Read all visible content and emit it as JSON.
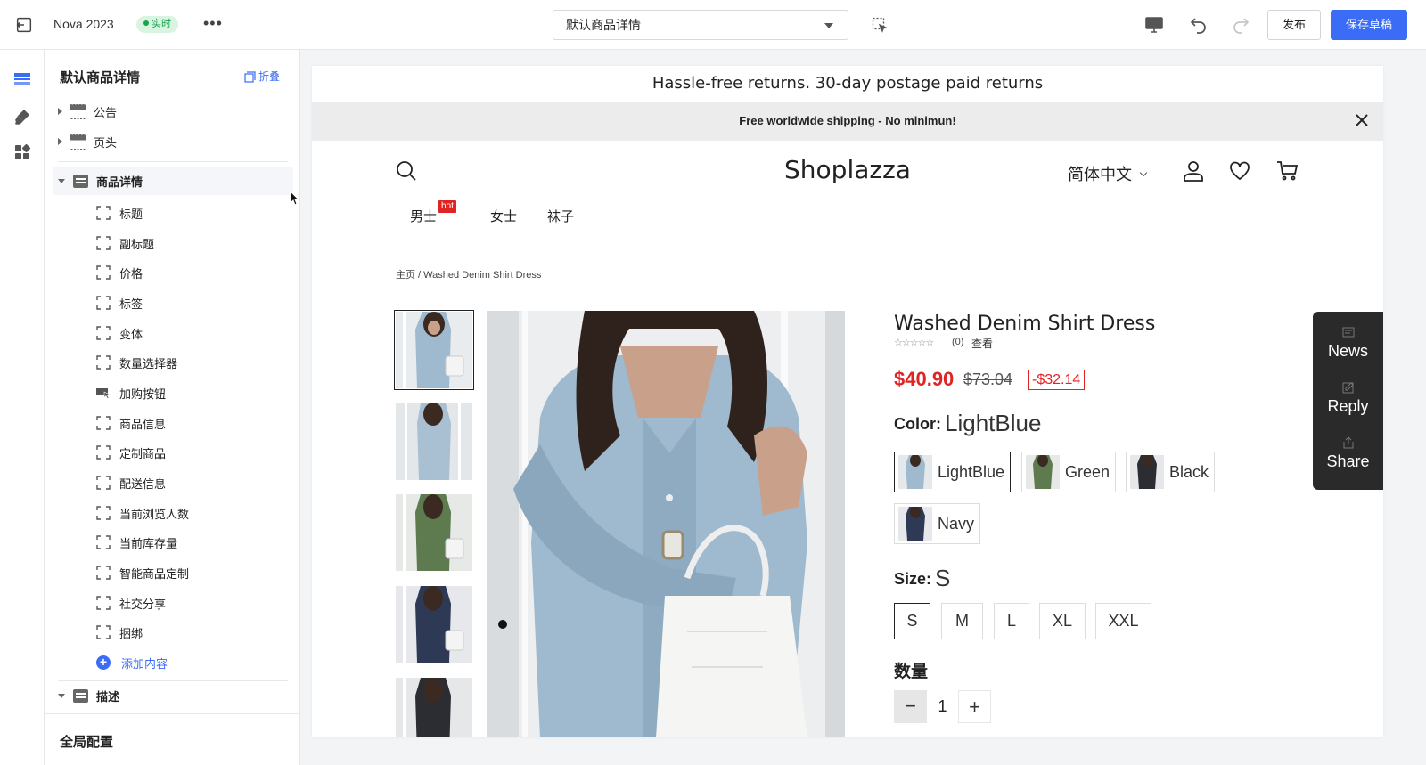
{
  "topbar": {
    "title": "Nova 2023",
    "badge": "实时",
    "more": "•••",
    "template_select": "默认商品详情",
    "publish": "发布",
    "save_draft": "保存草稿"
  },
  "sidebar": {
    "heading": "默认商品详情",
    "fold": "折叠",
    "sections": [
      {
        "label": "公告"
      },
      {
        "label": "页头"
      },
      {
        "label": "商品详情"
      },
      {
        "label": "描述"
      }
    ],
    "children": [
      "标题",
      "副标题",
      "价格",
      "标签",
      "变体",
      "数量选择器",
      "加购按钮",
      "商品信息",
      "定制商品",
      "配送信息",
      "当前浏览人数",
      "当前库存量",
      "智能商品定制",
      "社交分享",
      "捆绑"
    ],
    "add_content": "添加内容",
    "footer": "全局配置"
  },
  "preview": {
    "announcement_1": "Hassle-free returns. 30-day postage paid returns",
    "announcement_2": "Free worldwide shipping - No minimun!",
    "logo": "Shoplazza",
    "language": "简体中文",
    "nav": [
      "男士",
      "女士",
      "袜子"
    ],
    "nav_badge": "hot",
    "breadcrumb": "主页 / Washed Denim Shirt Dress",
    "product": {
      "title": "Washed Denim Shirt Dress",
      "stars": "☆☆☆☆☆",
      "rating": 0,
      "reviews": "(0)",
      "view": "查看",
      "price": "$40.90",
      "compare_price": "$73.04",
      "save": "-$32.14",
      "color_label": "Color:",
      "color_value": "LightBlue",
      "colors": [
        "LightBlue",
        "Green",
        "Black",
        "Navy"
      ],
      "size_label": "Size:",
      "size_value": "S",
      "sizes": [
        "S",
        "M",
        "L",
        "XL",
        "XXL"
      ],
      "qty_label": "数量",
      "qty": "1",
      "minus": "−",
      "plus": "+"
    },
    "float_panel": [
      "News",
      "Reply",
      "Share"
    ]
  },
  "colors": {
    "accent": "#3b6cf6",
    "live": "#16a34a",
    "sale": "#e02424",
    "denim_light": "#9fb9cf",
    "denim_green": "#5e7a4f",
    "denim_black": "#2b2d33",
    "denim_navy": "#2e3a55"
  }
}
